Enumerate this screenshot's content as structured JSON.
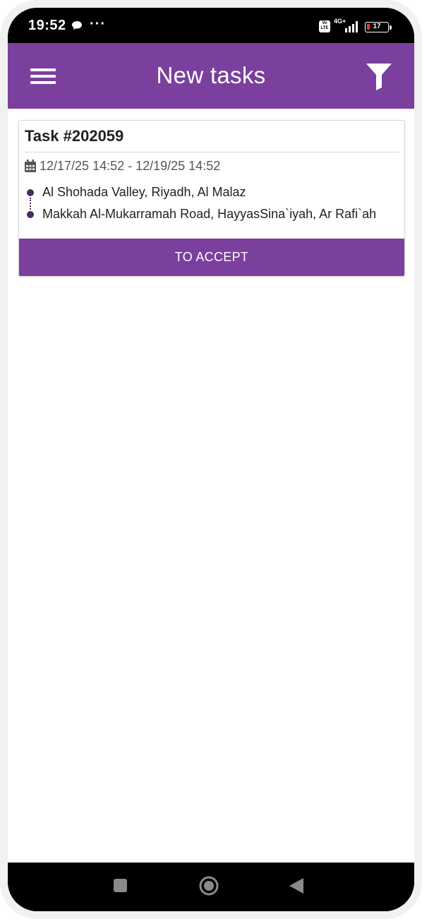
{
  "status_bar": {
    "time": "19:52",
    "notification_icon": "message-bubble-icon",
    "more_indicator": "···",
    "volte_label": "Vo LTE",
    "network_label": "4G+",
    "battery_level": "17",
    "battery_color": "#e53935"
  },
  "app_bar": {
    "title": "New tasks",
    "menu_icon": "hamburger-menu-icon",
    "filter_icon": "filter-icon",
    "color": "#7b3f9e"
  },
  "task": {
    "title": "Task #202059",
    "date_icon": "calendar-icon",
    "date_range": "12/17/25 14:52 - 12/19/25 14:52",
    "from_address": "Al Shohada Valley, Riyadh, Al Malaz",
    "to_address": "Makkah Al-Mukarramah Road, HayyasSina`iyah, Ar Rafi`ah",
    "accept_label": "TO ACCEPT"
  },
  "nav_bar": {
    "recent_icon": "recent-apps-icon",
    "home_icon": "home-icon",
    "back_icon": "back-icon"
  }
}
